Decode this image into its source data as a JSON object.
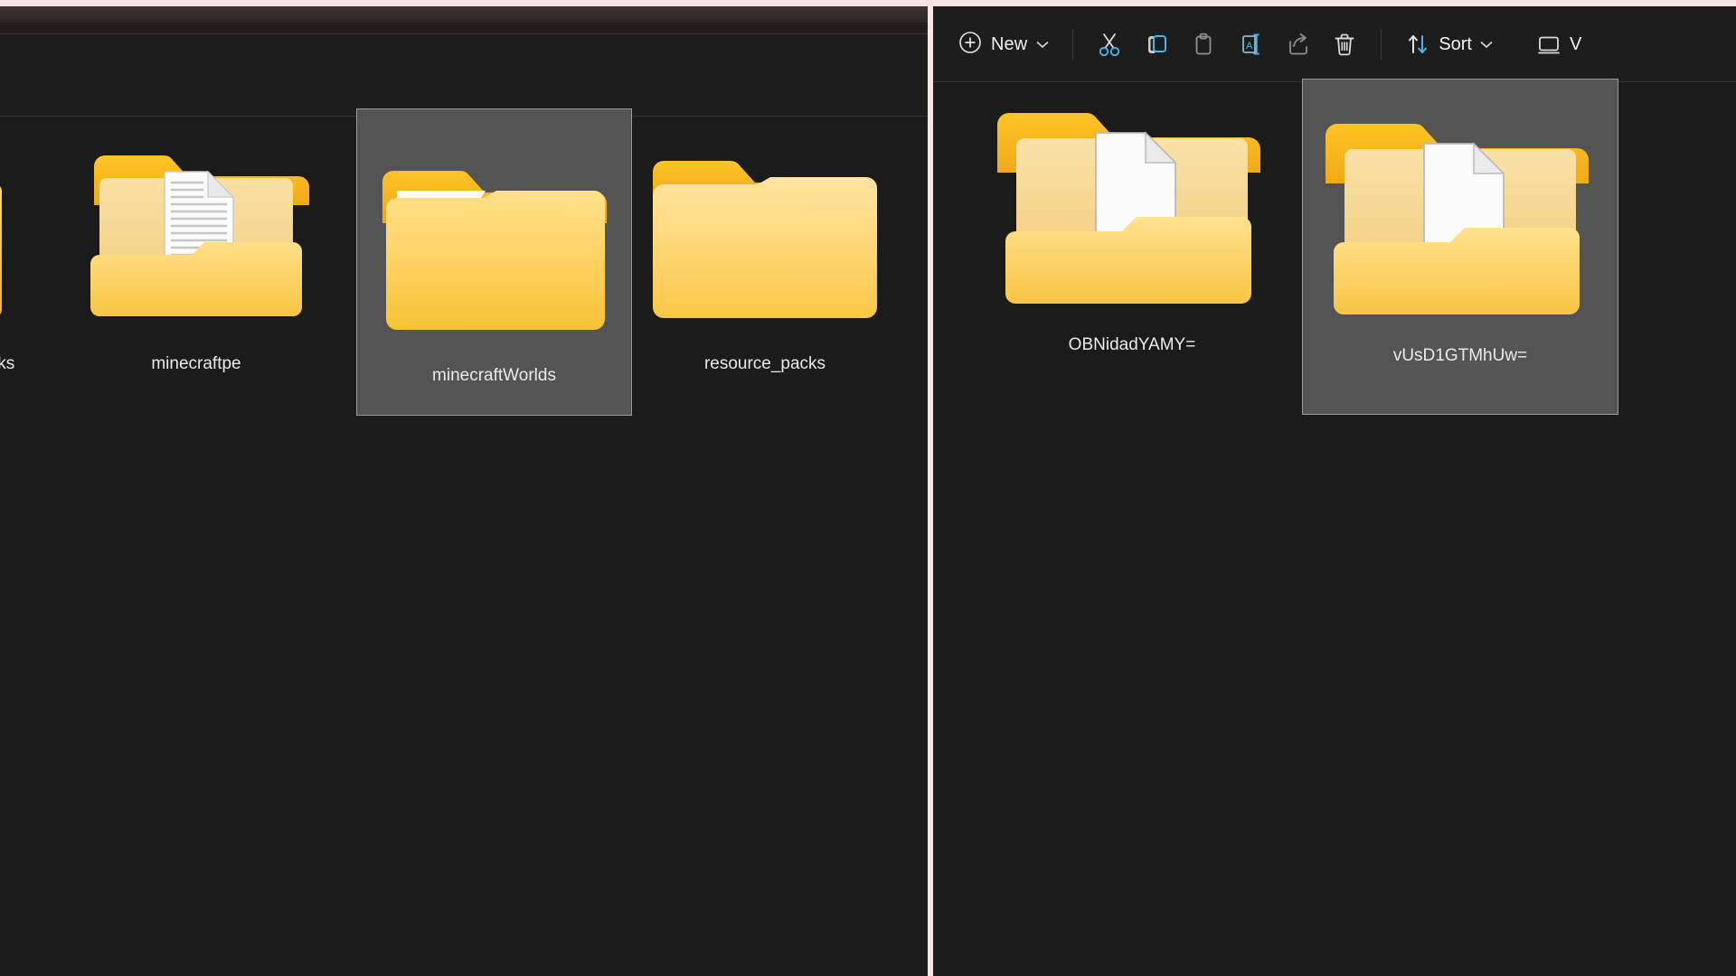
{
  "theme": {
    "window_bg": "#1b1b1b",
    "toolbar_bg": "#1d1d1d",
    "selection_bg": "#545454",
    "selection_border": "#9a9a9a",
    "text_primary": "#f2f2f2",
    "text_label": "#eaeaea",
    "divider": "#333333",
    "accent_blue": "#4cb4e7",
    "folder_tab": "#f4b821",
    "folder_body": "#ffd86b",
    "folder_back": "#f6dd9e",
    "page_gap": "#f9e4e4"
  },
  "left_window": {
    "name": "file-explorer-left",
    "content_bg": "#1b1b1b",
    "items": [
      {
        "label": "cks",
        "icon": "folder-closed",
        "selected": false,
        "clipped": true
      },
      {
        "label": "minecraftpe",
        "icon": "folder-open-with-document-lined",
        "selected": false,
        "clipped": false
      },
      {
        "label": "minecraftWorlds",
        "icon": "folder-closed-highlight",
        "selected": true,
        "clipped": false
      },
      {
        "label": "resource_packs",
        "icon": "folder-closed",
        "selected": false,
        "clipped": false
      }
    ]
  },
  "right_window": {
    "name": "file-explorer-right",
    "toolbar": {
      "new_label": "New",
      "new_icon": "plus-circle-icon",
      "new_chevron": "chevron-down-icon",
      "buttons": [
        {
          "id": "cut",
          "icon": "scissors-icon",
          "tooltip": "Cut"
        },
        {
          "id": "copy",
          "icon": "copy-icon",
          "tooltip": "Copy"
        },
        {
          "id": "paste",
          "icon": "clipboard-icon",
          "tooltip": "Paste"
        },
        {
          "id": "rename",
          "icon": "rename-icon",
          "tooltip": "Rename"
        },
        {
          "id": "share",
          "icon": "share-icon",
          "tooltip": "Share"
        },
        {
          "id": "delete",
          "icon": "trash-icon",
          "tooltip": "Delete"
        }
      ],
      "sort_label": "Sort",
      "sort_icon": "sort-arrows-icon",
      "sort_chevron": "chevron-down-icon",
      "view_label": "V",
      "view_icon": "monitor-icon"
    },
    "items": [
      {
        "label": "OBNidadYAMY=",
        "icon": "folder-open-with-document",
        "selected": false
      },
      {
        "label": "vUsD1GTMhUw=",
        "icon": "folder-open-with-document",
        "selected": true
      }
    ]
  }
}
